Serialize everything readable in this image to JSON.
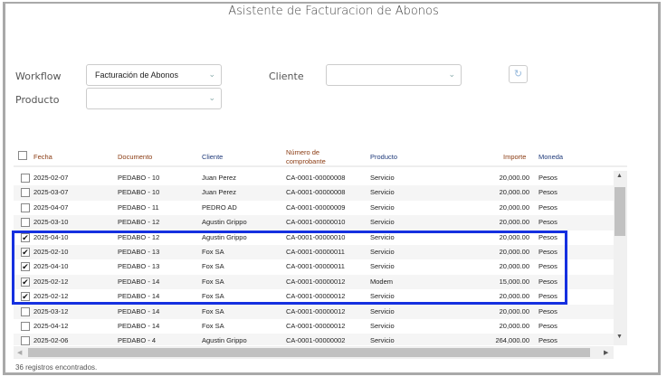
{
  "title": "Asistente de Facturacion de Abonos",
  "filters": {
    "workflow_label": "Workflow",
    "workflow_value": "Facturación de Abonos",
    "cliente_label": "Cliente",
    "cliente_value": "",
    "producto_label": "Producto",
    "producto_value": ""
  },
  "table": {
    "headers": [
      "Fecha",
      "Documento",
      "Cliente",
      "Número de comprobante",
      "Producto",
      "Importe",
      "Moneda"
    ],
    "rows": [
      {
        "checked": false,
        "fecha": "2025-02-07",
        "documento": "PEDABO - 10",
        "cliente": "Juan Perez",
        "numero": "CA-0001-00000008",
        "producto": "Servicio",
        "importe": "20,000.00",
        "moneda": "Pesos"
      },
      {
        "checked": false,
        "fecha": "2025-03-07",
        "documento": "PEDABO - 10",
        "cliente": "Juan Perez",
        "numero": "CA-0001-00000008",
        "producto": "Servicio",
        "importe": "20,000.00",
        "moneda": "Pesos"
      },
      {
        "checked": false,
        "fecha": "2025-04-07",
        "documento": "PEDABO - 11",
        "cliente": "PEDRO AD",
        "numero": "CA-0001-00000009",
        "producto": "Servicio",
        "importe": "20,000.00",
        "moneda": "Pesos"
      },
      {
        "checked": false,
        "fecha": "2025-03-10",
        "documento": "PEDABO - 12",
        "cliente": "Agustin Grippo",
        "numero": "CA-0001-00000010",
        "producto": "Servicio",
        "importe": "20,000.00",
        "moneda": "Pesos"
      },
      {
        "checked": true,
        "fecha": "2025-04-10",
        "documento": "PEDABO - 12",
        "cliente": "Agustin Grippo",
        "numero": "CA-0001-00000010",
        "producto": "Servicio",
        "importe": "20,000.00",
        "moneda": "Pesos"
      },
      {
        "checked": true,
        "fecha": "2025-02-10",
        "documento": "PEDABO - 13",
        "cliente": "Fox SA",
        "numero": "CA-0001-00000011",
        "producto": "Servicio",
        "importe": "20,000.00",
        "moneda": "Pesos"
      },
      {
        "checked": true,
        "fecha": "2025-04-10",
        "documento": "PEDABO - 13",
        "cliente": "Fox SA",
        "numero": "CA-0001-00000011",
        "producto": "Servicio",
        "importe": "20,000.00",
        "moneda": "Pesos"
      },
      {
        "checked": true,
        "fecha": "2025-02-12",
        "documento": "PEDABO - 14",
        "cliente": "Fox SA",
        "numero": "CA-0001-00000012",
        "producto": "Modem",
        "importe": "15,000.00",
        "moneda": "Pesos"
      },
      {
        "checked": true,
        "fecha": "2025-02-12",
        "documento": "PEDABO - 14",
        "cliente": "Fox SA",
        "numero": "CA-0001-00000012",
        "producto": "Servicio",
        "importe": "20,000.00",
        "moneda": "Pesos"
      },
      {
        "checked": false,
        "fecha": "2025-03-12",
        "documento": "PEDABO - 14",
        "cliente": "Fox SA",
        "numero": "CA-0001-00000012",
        "producto": "Servicio",
        "importe": "20,000.00",
        "moneda": "Pesos"
      },
      {
        "checked": false,
        "fecha": "2025-04-12",
        "documento": "PEDABO - 14",
        "cliente": "Fox SA",
        "numero": "CA-0001-00000012",
        "producto": "Servicio",
        "importe": "20,000.00",
        "moneda": "Pesos"
      },
      {
        "checked": false,
        "fecha": "2025-02-06",
        "documento": "PEDABO - 4",
        "cliente": "Agustin Grippo",
        "numero": "CA-0001-00000002",
        "producto": "Servicio",
        "importe": "264,000.00",
        "moneda": "Pesos"
      }
    ]
  },
  "footer": "36 registros encontrados.",
  "colors": {
    "highlight": "#1530e0",
    "header_brown": "#8a3b12",
    "header_navy": "#1f3a7a"
  }
}
